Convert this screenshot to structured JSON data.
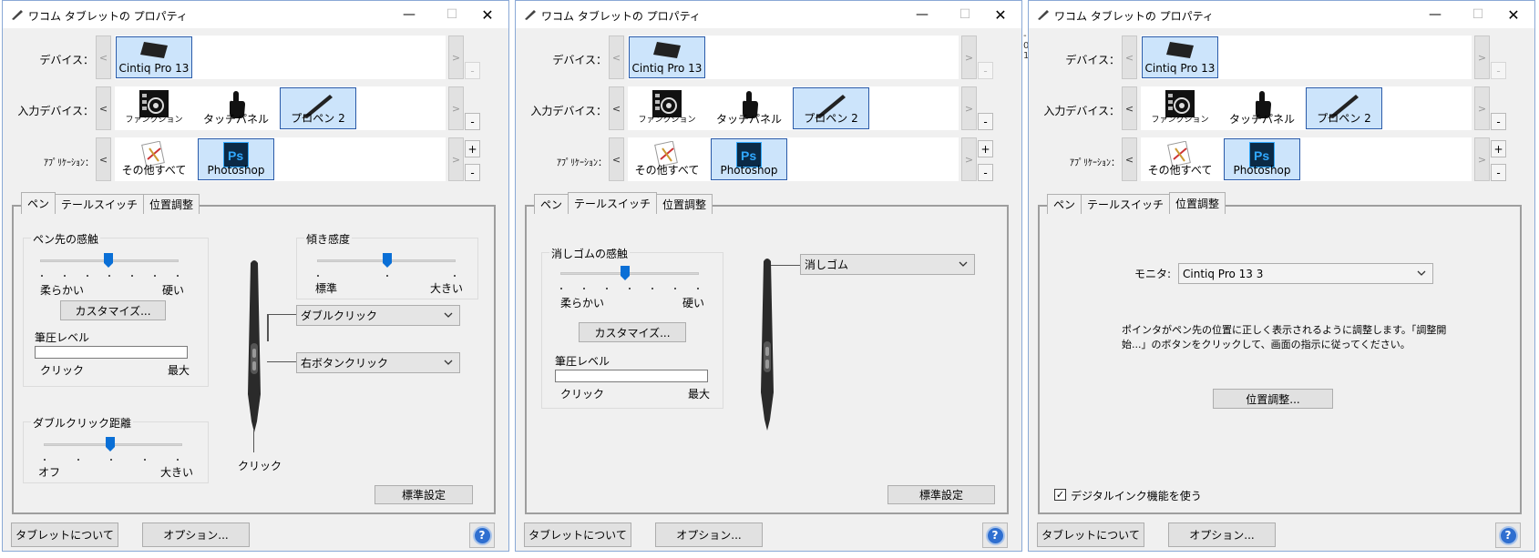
{
  "window": {
    "title": "ワコム タブレットの プロパティ",
    "min_glyph": "—",
    "max_glyph": "☐",
    "close_glyph": "✕"
  },
  "labels": {
    "device": "デバイス：",
    "input_device": "入力デバイス：",
    "application": "ｱﾌﾟﾘｹｰｼｮﾝ："
  },
  "device_tile": "Cintiq Pro 13",
  "input_tiles": {
    "function": "ファンクション",
    "touch": "タッチパネル",
    "pen": "プロペン 2"
  },
  "app_tiles": {
    "all_others": "その他すべて",
    "photoshop": "Photoshop"
  },
  "nav": {
    "left": "<",
    "right": ">",
    "plus": "+",
    "minus": "-"
  },
  "tabs": {
    "pen": "ペン",
    "tail": "テールスイッチ",
    "position": "位置調整"
  },
  "pen_tab": {
    "tip_feel": "ペン先の感触",
    "soft": "柔らかい",
    "firm": "硬い",
    "customize": "カスタマイズ...",
    "pressure_level": "筆圧レベル",
    "click": "クリック",
    "max": "最大",
    "tilt": "傾き感度",
    "normal": "標準",
    "large": "大きい",
    "double_click_distance": "ダブルクリック距離",
    "off": "オフ",
    "side_upper": "ダブルクリック",
    "side_lower": "右ボタンクリック",
    "tip_click": "クリック",
    "default": "標準設定"
  },
  "tail_tab": {
    "eraser_feel": "消しゴムの感触",
    "soft": "柔らかい",
    "firm": "硬い",
    "customize": "カスタマイズ...",
    "pressure_level": "筆圧レベル",
    "click": "クリック",
    "max": "最大",
    "eraser_combo": "消しゴム",
    "default": "標準設定"
  },
  "position_tab": {
    "monitor_label": "モニタ:",
    "monitor_value": "Cintiq Pro 13 3",
    "description_line1": "ポインタがペン先の位置に正しく表示されるように調整します。「調整開",
    "description_line2": "始...」のボタンをクリックして、画面の指示に従ってください。",
    "calibrate": "位置調整...",
    "digital_ink": "デジタルインク機能を使う",
    "checkmark": "✓"
  },
  "footer": {
    "about": "タブレットについて",
    "options": "オプション...",
    "help": "?"
  },
  "fragment": [
    "-",
    "0",
    "1"
  ],
  "colors": {
    "selection_fill": "#cce4fb",
    "selection_border": "#2a5aa8",
    "accent": "#0a6fd6"
  }
}
